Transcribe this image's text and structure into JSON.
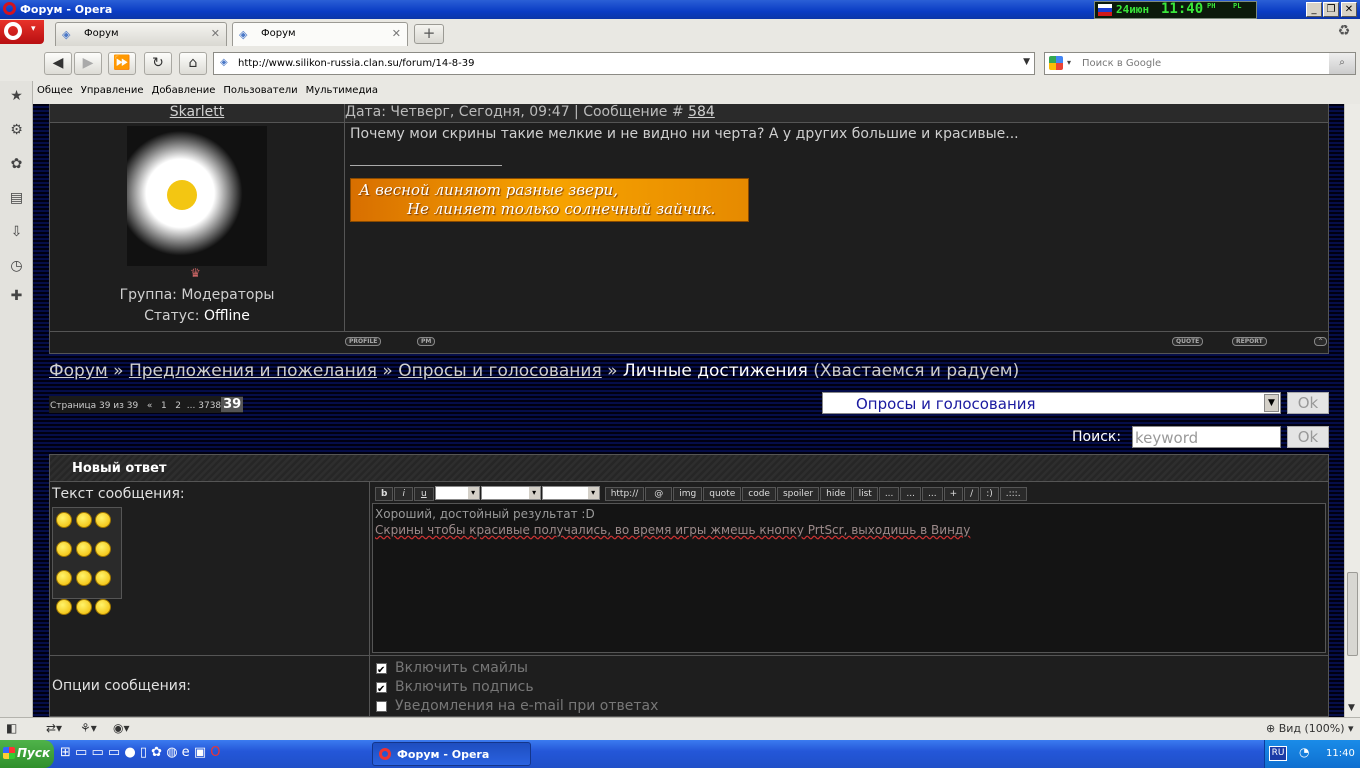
{
  "window": {
    "title": "Форум - Opera"
  },
  "widget": {
    "date": "24июн",
    "time": "11:40",
    "ph": "PH",
    "pl": "PL"
  },
  "tabs": [
    {
      "label": "Форум"
    },
    {
      "label": "Форум"
    }
  ],
  "nav": {
    "address": "http://www.silikon-russia.clan.su/forum/14-8-39",
    "search_placeholder": "Поиск в Google"
  },
  "bookmarks": [
    "Общее",
    "Управление",
    "Добавление",
    "Пользователи",
    "Мультимедиа"
  ],
  "post": {
    "author": "Skarlett",
    "meta_prefix": "Дата: Четверг, Сегодня, 09:47 | Сообщение # ",
    "number": "584",
    "text": "Почему мои скрины такие мелкие и не видно ни черта? А у других большие и красивые...",
    "banner_line1": "А весной линяют разные звери,",
    "banner_line2": "Не линяет только солнечный зайчик.",
    "group_label": "Группа: ",
    "group": "Модераторы",
    "status_label": "Статус: ",
    "status": "Offline",
    "btn_profile": "PROFILE",
    "btn_pm": "PM",
    "btn_quote": "QUOTE",
    "btn_report": "REPORT"
  },
  "breadcrumb": {
    "forum": "Форум",
    "sep": " » ",
    "section": "Предложения и пожелания",
    "subsection": "Опросы и голосования",
    "current": "Личные достижения",
    "desc": "(Хвастаемся и радуем)"
  },
  "pagination": {
    "label": "Страница 39 из 39",
    "prev": "«",
    "p1": "1",
    "p2": "2",
    "ellipsis": "...",
    "p37": "37",
    "p38": "38",
    "current": "39"
  },
  "jump": {
    "selected": "Опросы и голосования",
    "ok": "Ok"
  },
  "search": {
    "label": "Поиск:",
    "value": "keyword",
    "ok": "Ok"
  },
  "reply": {
    "header": "Новый ответ",
    "text_label": "Текст сообщения:",
    "line1": "Хороший, достойный результат :D",
    "line2": "Скрины чтобы красивые получались, во время игры жмешь кнопку PrtScr, выходишь в Винду",
    "options_label": "Опции сообщения:",
    "opt1": "Включить смайлы",
    "opt2": "Включить подпись",
    "opt3": "Уведомления на e-mail при ответах"
  },
  "toolbar": {
    "b": "b",
    "i": "i",
    "u": "u",
    "http": "http://",
    "at": "@",
    "img": "img",
    "quote": "quote",
    "code": "code",
    "spoiler": "spoiler",
    "hide": "hide",
    "list": "list",
    "dots": "...",
    "plus": "+",
    "slash": "/",
    "smile": ":)",
    "dotsmall": ".:::."
  },
  "statusbar": {
    "zoom": "Вид (100%)"
  },
  "taskbar": {
    "start": "Пуск",
    "task": "Форум - Opera",
    "lang": "RU",
    "time": "11:40"
  }
}
